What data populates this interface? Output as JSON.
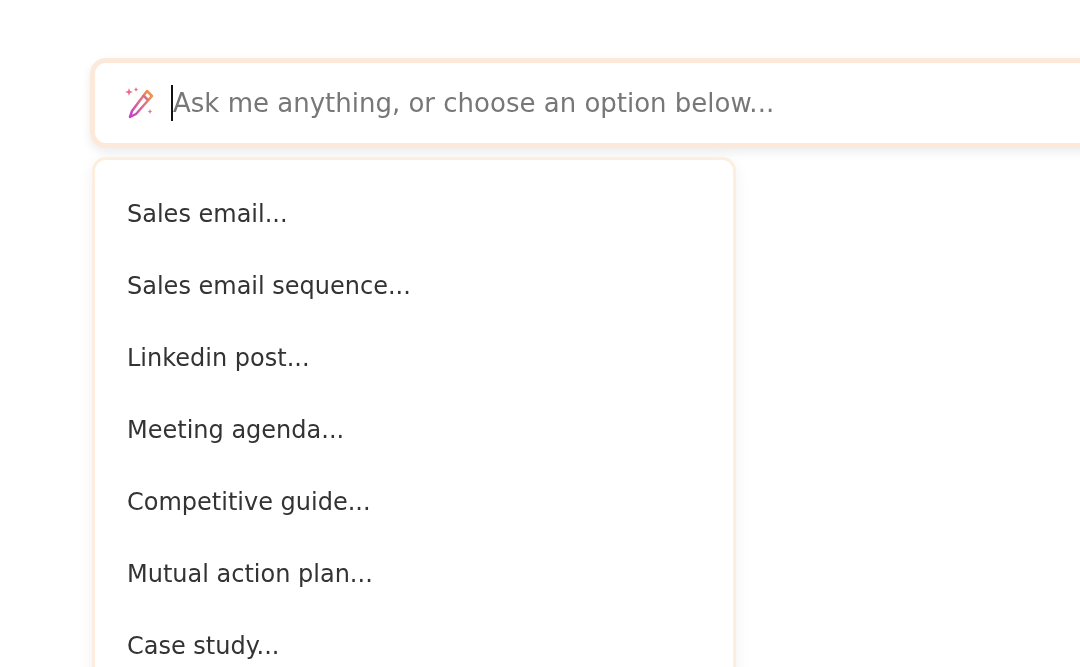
{
  "prompt": {
    "placeholder": "Ask me anything, or choose an option below..."
  },
  "options": [
    {
      "label": "Sales email..."
    },
    {
      "label": "Sales email sequence..."
    },
    {
      "label": "Linkedin post..."
    },
    {
      "label": "Meeting agenda..."
    },
    {
      "label": "Competitive guide..."
    },
    {
      "label": "Mutual action plan..."
    },
    {
      "label": "Case study..."
    }
  ]
}
